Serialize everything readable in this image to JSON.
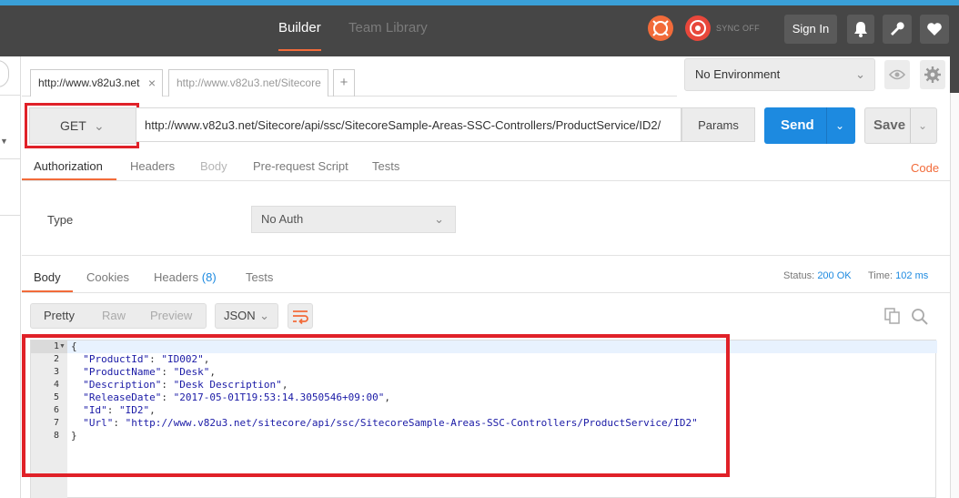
{
  "colors": {
    "accent": "#f26b3a",
    "primary": "#1d8ae0",
    "topbar": "#464646",
    "highlight": "#e02128"
  },
  "header": {
    "tabs": [
      {
        "label": "Builder",
        "active": true
      },
      {
        "label": "Team Library",
        "active": false
      }
    ],
    "sync_label": "SYNC OFF",
    "sign_in": "Sign In",
    "icons": [
      "interceptor-icon",
      "sync-icon",
      "bell-icon",
      "wrench-icon",
      "heart-icon"
    ]
  },
  "request_tabs": [
    {
      "label": "http://www.v82u3.net",
      "closable": true
    },
    {
      "label": "http://www.v82u3.net/Sitecore"
    }
  ],
  "environment": {
    "selected": "No Environment",
    "icons": [
      "eye-icon",
      "gear-icon"
    ]
  },
  "request": {
    "method": "GET",
    "url": "http://www.v82u3.net/Sitecore/api/ssc/SitecoreSample-Areas-SSC-Controllers/ProductService/ID2/",
    "params_label": "Params",
    "send_label": "Send",
    "save_label": "Save"
  },
  "request_subtabs": [
    "Authorization",
    "Headers",
    "Body",
    "Pre-request Script",
    "Tests"
  ],
  "code_link": "Code",
  "auth": {
    "type_label": "Type",
    "selected": "No Auth"
  },
  "response_tabs": [
    {
      "label": "Body"
    },
    {
      "label": "Cookies"
    },
    {
      "label": "Headers",
      "count": "(8)"
    },
    {
      "label": "Tests"
    }
  ],
  "status": {
    "status_label": "Status:",
    "status_value": "200 OK",
    "time_label": "Time:",
    "time_value": "102 ms"
  },
  "view_modes": [
    "Pretty",
    "Raw",
    "Preview"
  ],
  "format": "JSON",
  "response_body": {
    "line_numbers": [
      "1",
      "2",
      "3",
      "4",
      "5",
      "6",
      "7",
      "8"
    ],
    "lines": [
      {
        "text": "{"
      },
      {
        "key": "\"ProductId\"",
        "value": "\"ID002\"",
        "comma": true
      },
      {
        "key": "\"ProductName\"",
        "value": "\"Desk\"",
        "comma": true
      },
      {
        "key": "\"Description\"",
        "value": "\"Desk Description\"",
        "comma": true
      },
      {
        "key": "\"ReleaseDate\"",
        "value": "\"2017-05-01T19:53:14.3050546+09:00\"",
        "comma": true
      },
      {
        "key": "\"Id\"",
        "value": "\"ID2\"",
        "comma": true
      },
      {
        "key": "\"Url\"",
        "value": "\"http://www.v82u3.net/sitecore/api/ssc/SitecoreSample-Areas-SSC-Controllers/ProductService/ID2\"",
        "comma": false
      },
      {
        "text": "}"
      }
    ]
  }
}
